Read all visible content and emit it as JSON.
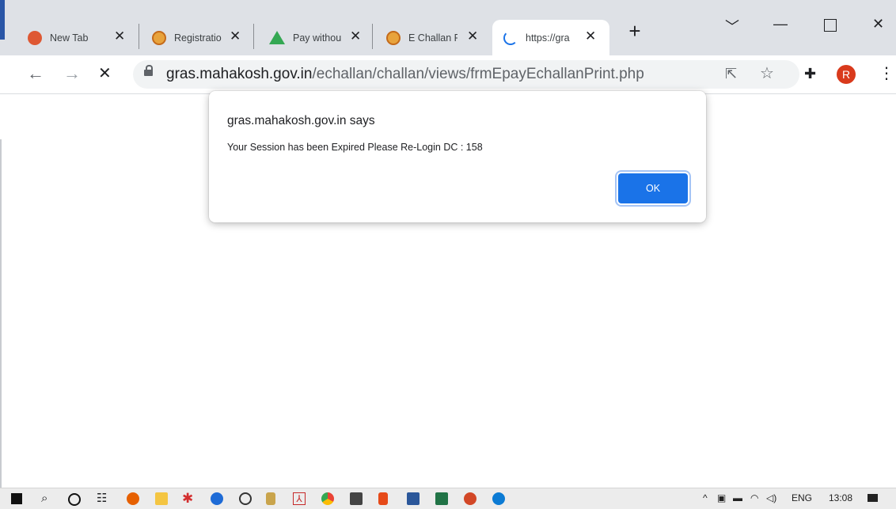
{
  "browser": {
    "tabs": [
      {
        "label": "New Tab",
        "favicon": "duckduckgo-icon",
        "color": "#de5833"
      },
      {
        "label": "Registratio",
        "favicon": "emblem-icon",
        "color": "#e8a33c"
      },
      {
        "label": "Pay withou",
        "favicon": "google-drive-icon",
        "color": "#34a853"
      },
      {
        "label": "E Challan F",
        "favicon": "emblem-icon",
        "color": "#e8a33c"
      },
      {
        "label": "https://gra",
        "favicon": "loading-spinner-icon",
        "color": "#1a73e8"
      }
    ],
    "url_host": "gras.mahakosh.gov.in",
    "url_path": "/echallan/challan/views/frmEpayEchallanPrint.php",
    "profile_initial": "R",
    "profile_color": "#d93a1c"
  },
  "dialog": {
    "title": "gras.mahakosh.gov.in says",
    "message": "Your Session has been Expired Please Re-Login DC : 158",
    "ok_label": "OK",
    "accent": "#1a73e8"
  },
  "taskbar": {
    "language": "ENG",
    "time": "13:08",
    "apps": [
      "windows-start-icon",
      "search-icon",
      "cortana-icon",
      "task-view-icon",
      "firefox-icon",
      "file-explorer-icon",
      "app-icon",
      "github-icon",
      "app-icon",
      "app-icon",
      "acrobat-icon",
      "chrome-icon",
      "app-icon",
      "office-icon",
      "word-icon",
      "excel-icon",
      "powerpoint-icon",
      "edge-icon"
    ]
  }
}
